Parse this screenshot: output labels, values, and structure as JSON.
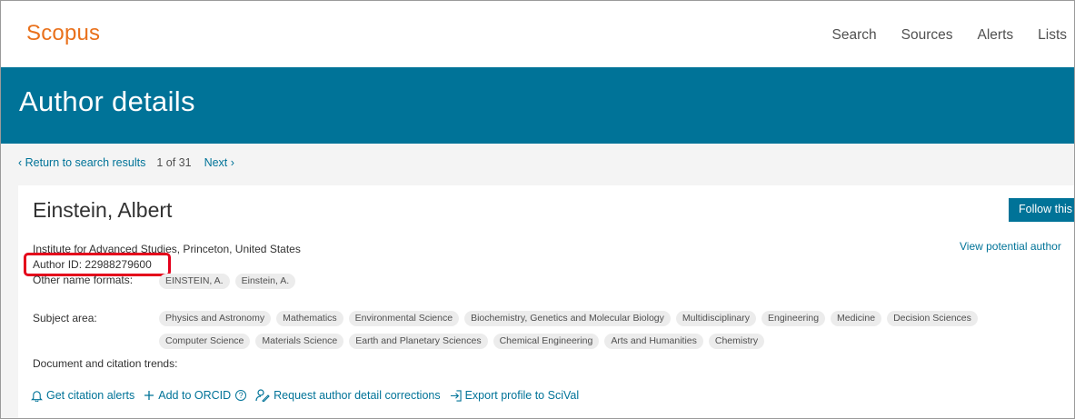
{
  "header": {
    "logo": "Scopus",
    "nav": [
      "Search",
      "Sources",
      "Alerts",
      "Lists"
    ]
  },
  "banner": {
    "title": "Author details"
  },
  "breadcrumb": {
    "return_label": "‹ Return to search results",
    "count": "1 of 31",
    "next_label": "Next ›"
  },
  "author": {
    "name": "Einstein, Albert",
    "affiliation": "Institute for Advanced Studies, Princeton, United States",
    "author_id": "Author ID: 22988279600",
    "follow_label": "Follow this",
    "view_potential_label": "View potential author"
  },
  "other_names": {
    "label": "Other name formats:",
    "items": [
      "EINSTEIN, A.",
      "Einstein, A."
    ]
  },
  "subject_area": {
    "label": "Subject area:",
    "row1": [
      "Physics and Astronomy",
      "Mathematics",
      "Environmental Science",
      "Biochemistry, Genetics and Molecular Biology",
      "Multidisciplinary",
      "Engineering",
      "Medicine",
      "Decision Sciences"
    ],
    "row2": [
      "Computer Science",
      "Materials Science",
      "Earth and Planetary Sciences",
      "Chemical Engineering",
      "Arts and Humanities",
      "Chemistry"
    ]
  },
  "trends_label": "Document and citation trends:",
  "actions": {
    "alerts": "Get citation alerts",
    "orcid": "Add to ORCID",
    "orcid_help": "?",
    "corrections": "Request author detail corrections",
    "export": "Export profile to SciVal"
  },
  "colors": {
    "brand_orange": "#e9711c",
    "teal": "#007398",
    "highlight": "#e4001b"
  },
  "icons": [
    "bell-icon",
    "plus-icon",
    "help-icon",
    "person-edit-icon",
    "export-icon"
  ]
}
